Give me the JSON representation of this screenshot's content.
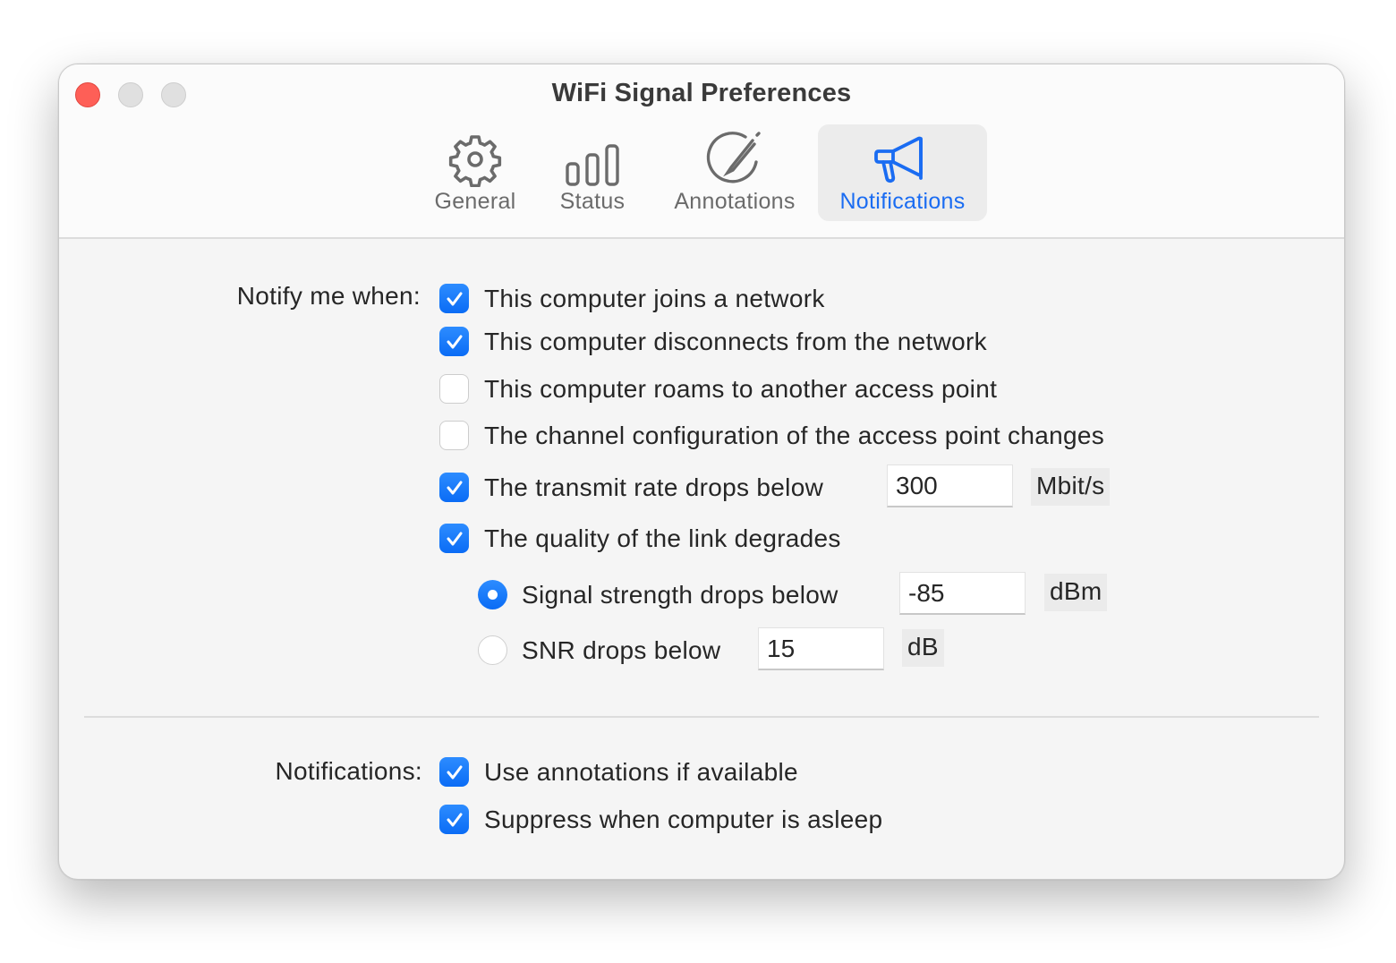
{
  "window": {
    "title": "WiFi Signal Preferences",
    "controls": {
      "close": "close",
      "minimize": "minimize",
      "zoom": "zoom"
    }
  },
  "tabs": [
    {
      "label": "General",
      "icon": "gear-icon",
      "active": false
    },
    {
      "label": "Status",
      "icon": "bars-icon",
      "active": false
    },
    {
      "label": "Annotations",
      "icon": "pencil-circle-icon",
      "active": false
    },
    {
      "label": "Notifications",
      "icon": "megaphone-icon",
      "active": true
    }
  ],
  "notify": {
    "label": "Notify me when:",
    "options": [
      {
        "label": "This computer joins a network",
        "checked": true
      },
      {
        "label": "This computer disconnects from the network",
        "checked": true
      },
      {
        "label": "This computer roams to another access point",
        "checked": false
      },
      {
        "label": "The channel configuration of the access point changes",
        "checked": false
      },
      {
        "label": "The transmit rate drops below",
        "checked": true,
        "value": "300",
        "unit": "Mbit/s"
      },
      {
        "label": "The quality of the link degrades",
        "checked": true
      }
    ],
    "quality_radios": [
      {
        "label": "Signal strength drops below",
        "selected": true,
        "value": "-85",
        "unit": "dBm"
      },
      {
        "label": "SNR drops below",
        "selected": false,
        "value": "15",
        "unit": "dB"
      }
    ]
  },
  "notifications": {
    "label": "Notifications:",
    "options": [
      {
        "label": "Use annotations if available",
        "checked": true
      },
      {
        "label": "Suppress when computer is asleep",
        "checked": true
      }
    ]
  },
  "colors": {
    "accent": "#0a6cf5",
    "close": "#fe5f57",
    "background": "#f5f5f5"
  }
}
